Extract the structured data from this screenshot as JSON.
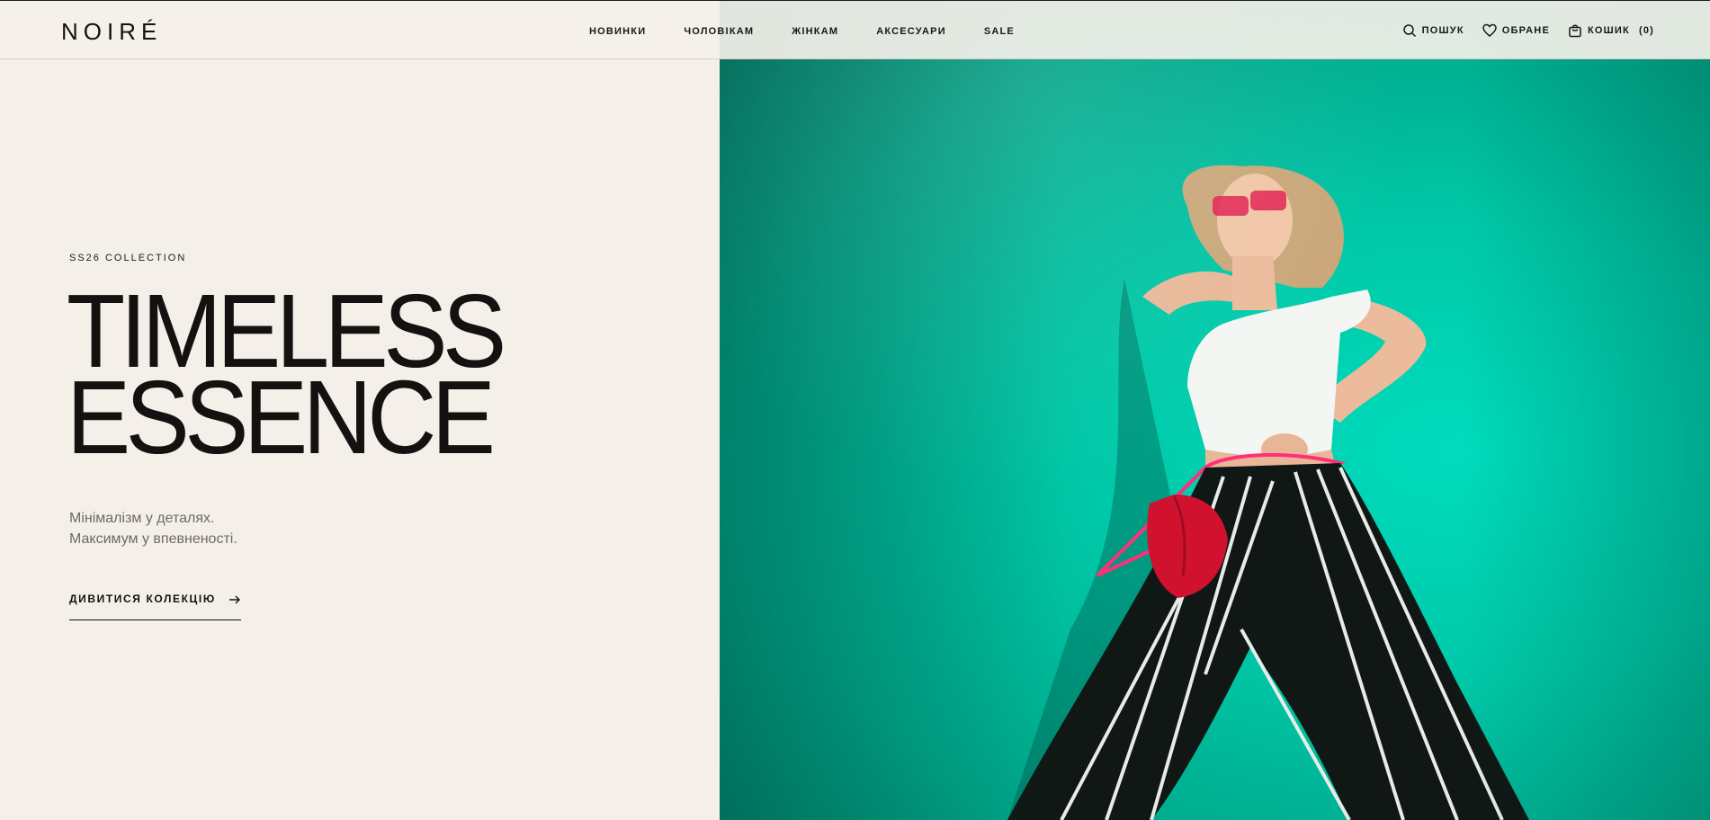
{
  "brand": {
    "logo": "NOIRÉ"
  },
  "nav": {
    "items": [
      {
        "label": "НОВИНКИ"
      },
      {
        "label": "ЧОЛОВІКАМ"
      },
      {
        "label": "ЖІНКАМ"
      },
      {
        "label": "АКСЕСУАРИ"
      },
      {
        "label": "SALE"
      }
    ]
  },
  "utility": {
    "search_label": "ПОШУК",
    "favorites_label": "ОБРАНЕ",
    "cart_label": "КОШИК",
    "cart_count": "(0)"
  },
  "hero": {
    "eyebrow": "SS26 COLLECTION",
    "headline_line1": "TIMELESS",
    "headline_line2": "ESSENCE",
    "sub_line1": "Мінімалізм у деталях.",
    "sub_line2": "Максимум у впевненості.",
    "cta_label": "ДИВИТИСЯ КОЛЕКЦІЮ"
  },
  "colors": {
    "background": "#f4f0e9",
    "text": "#141210",
    "muted": "#6e6a63",
    "image_teal": "#00c9a8"
  },
  "icons": [
    "search-icon",
    "heart-icon",
    "bag-icon",
    "arrow-right-icon"
  ]
}
